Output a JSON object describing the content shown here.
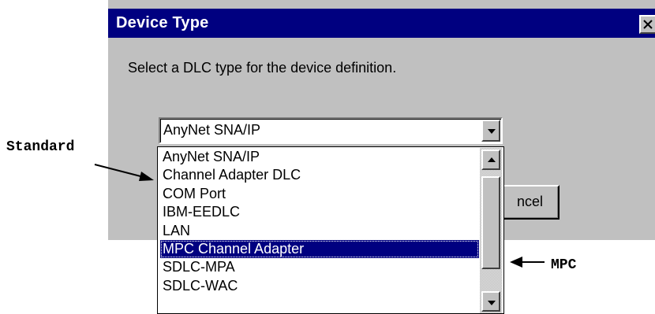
{
  "dialog": {
    "title": "Device Type",
    "instruction": "Select a DLC type for the device definition.",
    "combo_value": "AnyNet SNA/IP",
    "cancel_label_visible": "ncel"
  },
  "dropdown": {
    "items": [
      "AnyNet SNA/IP",
      "Channel Adapter DLC",
      "COM Port",
      "IBM-EEDLC",
      "LAN",
      "MPC Channel Adapter",
      "SDLC-MPA",
      "SDLC-WAC"
    ],
    "selected_index": 5
  },
  "annotations": {
    "standard": "Standard",
    "mpc": "MPC"
  },
  "colors": {
    "titlebar": "#000080",
    "dialog_face": "#c0c0c0",
    "selection": "#000080"
  },
  "icons": [
    "close-icon",
    "chevron-down-icon",
    "scroll-up-icon",
    "scroll-down-icon"
  ]
}
